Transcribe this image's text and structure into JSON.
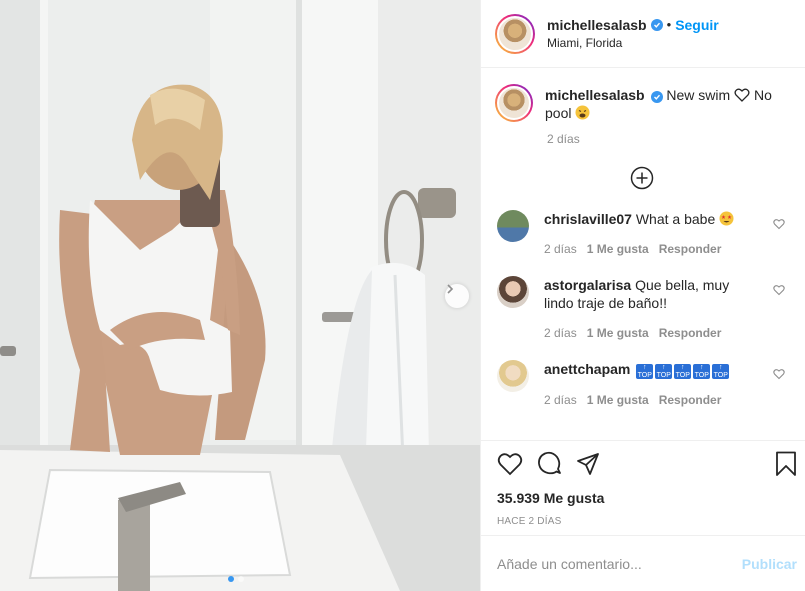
{
  "post": {
    "image_alt": "Woman in white one-piece swimsuit taking a mirror selfie in a bathroom",
    "carousel": {
      "count": 2,
      "active": 0
    }
  },
  "header": {
    "username": "michellesalasb",
    "separator": "•",
    "follow_label": "Seguir",
    "location": "Miami, Florida"
  },
  "caption": {
    "username": "michellesalasb",
    "text": "New swim",
    "text_after": "No pool",
    "time": "2 días"
  },
  "comments": [
    {
      "username": "chrislaville07",
      "text": "What a babe",
      "time": "2 días",
      "likes": "1 Me gusta",
      "reply": "Responder",
      "avatar_color": "#7c8f6e"
    },
    {
      "username": "astorgalarisa",
      "text": "Que bella, muy lindo traje de baño!!",
      "time": "2 días",
      "likes": "1 Me gusta",
      "reply": "Responder",
      "avatar_color": "#b89a86"
    },
    {
      "username": "anettchapam",
      "text": "",
      "time": "2 días",
      "likes": "1 Me gusta",
      "reply": "Responder",
      "avatar_color": "#e3d2a8"
    }
  ],
  "stats": {
    "likes": "35.939 Me gusta",
    "posted": "HACE 2 DÍAS"
  },
  "composer": {
    "placeholder": "Añade un comentario...",
    "publish_label": "Publicar"
  },
  "colors": {
    "accent": "#0095f6",
    "verified": "#3897f0",
    "muted": "#8e8e8e",
    "publish_disabled": "#b2dffc"
  },
  "icons": [
    "verified-icon",
    "load-more-icon",
    "heart-icon",
    "comment-icon",
    "share-icon",
    "bookmark-icon",
    "chevron-right-icon"
  ]
}
